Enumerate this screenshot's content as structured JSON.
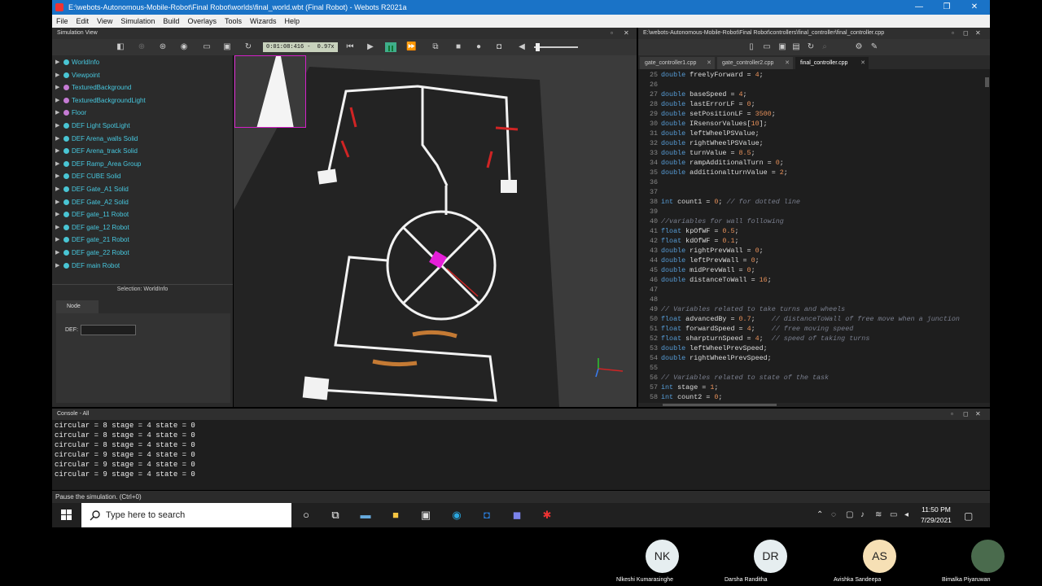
{
  "window": {
    "title": "E:\\webots-Autonomous-Mobile-Robot\\Final Robot\\worlds\\final_world.wbt (Final Robot) - Webots R2021a",
    "controls": [
      "—",
      "❐",
      "✕"
    ]
  },
  "menu": [
    "File",
    "Edit",
    "View",
    "Simulation",
    "Build",
    "Overlays",
    "Tools",
    "Wizards",
    "Help"
  ],
  "simulation_view": {
    "title": "Simulation View",
    "time": "0:01:08:416",
    "separator": "-",
    "speed": "0.97x"
  },
  "scene_tree": [
    {
      "label": "WorldInfo",
      "dot": "#49c5d4"
    },
    {
      "label": "Viewpoint",
      "dot": "#49c5d4"
    },
    {
      "label": "TexturedBackground",
      "dot": "#c57bd4"
    },
    {
      "label": "TexturedBackgroundLight",
      "dot": "#c57bd4"
    },
    {
      "label": "Floor",
      "dot": "#c57bd4"
    },
    {
      "label": "DEF Light SpotLight",
      "dot": "#49c5d4"
    },
    {
      "label": "DEF Arena_walls Solid",
      "dot": "#49c5d4"
    },
    {
      "label": "DEF Arena_track Solid",
      "dot": "#49c5d4"
    },
    {
      "label": "DEF Ramp_Area Group",
      "dot": "#49c5d4"
    },
    {
      "label": "DEF CUBE Solid",
      "dot": "#49c5d4"
    },
    {
      "label": "DEF Gate_A1 Solid",
      "dot": "#49c5d4"
    },
    {
      "label": "DEF Gate_A2 Solid",
      "dot": "#49c5d4"
    },
    {
      "label": "DEF gate_11 Robot",
      "dot": "#49c5d4"
    },
    {
      "label": "DEF gate_12 Robot",
      "dot": "#49c5d4"
    },
    {
      "label": "DEF gate_21 Robot",
      "dot": "#49c5d4"
    },
    {
      "label": "DEF gate_22 Robot",
      "dot": "#49c5d4"
    },
    {
      "label": "DEF main Robot",
      "dot": "#49c5d4"
    }
  ],
  "selection": {
    "label": "Selection: WorldInfo",
    "tab": "Node",
    "def_label": "DEF:",
    "def_value": ""
  },
  "editor": {
    "path": "E:\\webots-Autonomous-Mobile-Robot\\Final Robot\\controllers\\final_controller\\final_controller.cpp",
    "tabs": [
      "gate_controller1.cpp",
      "gate_controller2.cpp",
      "final_controller.cpp"
    ],
    "lines": [
      {
        "n": "25",
        "t": "double freelyForward = 4;"
      },
      {
        "n": "26",
        "t": ""
      },
      {
        "n": "27",
        "t": "double baseSpeed = 4;"
      },
      {
        "n": "28",
        "t": "double lastErrorLF = 0;"
      },
      {
        "n": "29",
        "t": "double setPositionLF = 3500;"
      },
      {
        "n": "30",
        "t": "double IRsensorValues[10];"
      },
      {
        "n": "31",
        "t": "double leftWheelPSValue;"
      },
      {
        "n": "32",
        "t": "double rightWheelPSValue;"
      },
      {
        "n": "33",
        "t": "double turnValue = 8.5;"
      },
      {
        "n": "34",
        "t": "double rampAdditionalTurn = 0;"
      },
      {
        "n": "35",
        "t": "double additionalturnValue = 2;"
      },
      {
        "n": "36",
        "t": ""
      },
      {
        "n": "37",
        "t": ""
      },
      {
        "n": "38",
        "t": "int count1 = 0; // for dotted line"
      },
      {
        "n": "39",
        "t": ""
      },
      {
        "n": "40",
        "t": "//variables for wall following"
      },
      {
        "n": "41",
        "t": "float kpOfWF = 0.5;"
      },
      {
        "n": "42",
        "t": "float kdOfWF = 0.1;"
      },
      {
        "n": "43",
        "t": "double rightPrevWall = 0;"
      },
      {
        "n": "44",
        "t": "double leftPrevWall = 0;"
      },
      {
        "n": "45",
        "t": "double midPrevWall = 0;"
      },
      {
        "n": "46",
        "t": "double distanceToWall = 16;"
      },
      {
        "n": "47",
        "t": ""
      },
      {
        "n": "48",
        "t": ""
      },
      {
        "n": "49",
        "t": "// Variables related to take turns and wheels"
      },
      {
        "n": "50",
        "t": "float advancedBy = 0.7;    // distanceToWall of free move when a junction"
      },
      {
        "n": "51",
        "t": "float forwardSpeed = 4;    // free moving speed"
      },
      {
        "n": "52",
        "t": "float sharpturnSpeed = 4;  // speed of taking turns"
      },
      {
        "n": "53",
        "t": "double leftWheelPrevSpeed;"
      },
      {
        "n": "54",
        "t": "double rightWheelPrevSpeed;"
      },
      {
        "n": "55",
        "t": ""
      },
      {
        "n": "56",
        "t": "// Variables related to state of the task"
      },
      {
        "n": "57",
        "t": "int stage = 1;"
      },
      {
        "n": "58",
        "t": "int count2 = 0;"
      }
    ]
  },
  "console": {
    "title": "Console - All",
    "lines": [
      "circular = 8 stage = 4 state = 0",
      "circular = 8 stage = 4 state = 0",
      "circular = 8 stage = 4 state = 0",
      "circular = 9 stage = 4 state = 0",
      "circular = 9 stage = 4 state = 0",
      "circular = 9 stage = 4 state = 0"
    ]
  },
  "status": "Pause the simulation. (Ctrl+0)",
  "taskbar": {
    "search_placeholder": "Type here to search",
    "time": "11:50 PM",
    "date": "7/29/2021"
  },
  "participants": [
    {
      "initials": "NK",
      "name": "Nlkeshi Kumarasinghe",
      "color": "#e6eef0"
    },
    {
      "initials": "DR",
      "name": "Darsha Randitha",
      "color": "#e6eef0"
    },
    {
      "initials": "AS",
      "name": "Avishka Sandeepa",
      "color": "#f6e0b5"
    },
    {
      "initials": "",
      "name": "Bimalka Piyaruwan",
      "color": "#4a6b4d"
    }
  ]
}
